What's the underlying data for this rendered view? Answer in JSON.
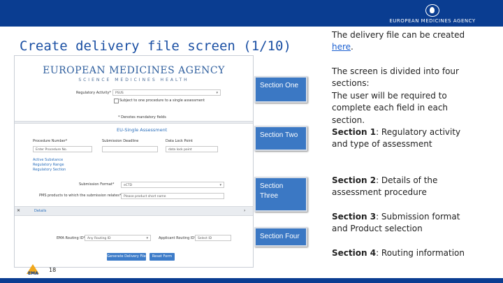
{
  "header": {
    "logo_text": "EUROPEAN MEDICINES AGENCY"
  },
  "slide": {
    "title": "Create delivery file screen (1/10)",
    "page_number": "18",
    "footer_logo": "EMA"
  },
  "screenshot": {
    "org": "EUROPEAN MEDICINES AGENCY",
    "tagline": "SCIENCE MEDICINES HEALTH",
    "regulatory_activity_label": "Regulatory Activity*",
    "regulatory_activity_value": "PSUS",
    "single_assessment_check": "Subject to one procedure to a single assessment",
    "mandatory_note": "* Denotes mandatory fields",
    "section_title": "EU-Single Assessment",
    "procedure_number_label": "Procedure Number*",
    "procedure_number_placeholder": "Enter Procedure No.",
    "submission_deadline_label": "Submission Deadline",
    "data_lock_point_label": "Data Lock Point",
    "data_lock_point_placeholder": "data lock point",
    "links": [
      "Active Substance",
      "Regulatory Range",
      "Regulatory Section"
    ],
    "submission_format_label": "Submission Format*",
    "submission_format_value": "eCTD",
    "pms_products_label": "PMS products to which the submission relates*",
    "pms_products_placeholder": "Please product short name",
    "collapse_label": "Details",
    "ema_routing_label": "EMA Routing ID*",
    "ema_routing_value": "Any Routing ID",
    "applicant_routing_label": "Applicant Routing ID*",
    "applicant_routing_value": "Select ID",
    "generate_button": "Generate Delivery File",
    "reset_button": "Reset Form"
  },
  "section_tags": {
    "one": "Section One",
    "two": "Section Two",
    "three": "Section Three",
    "four": "Section Four"
  },
  "notes": {
    "p1_text": "The delivery file can be created ",
    "p1_link": "here",
    "p1_end": ".",
    "p2_text": "The screen is divided into four sections:",
    "p3_text": "The user will be required to complete each field in each section.",
    "s1_label": "Section 1",
    "s1_text": ": Regulatory activity and type of assessment",
    "s2_label": "Section 2",
    "s2_text": ": Details of the assessment procedure",
    "s3_label": "Section 3",
    "s3_text": ": Submission format and Product selection",
    "s4_label": "Section 4",
    "s4_text": ": Routing information"
  },
  "colors": {
    "bar": "#0a3d91",
    "title": "#1a4fa3",
    "tag": "#3b78c4",
    "link": "#1a5fd1"
  }
}
